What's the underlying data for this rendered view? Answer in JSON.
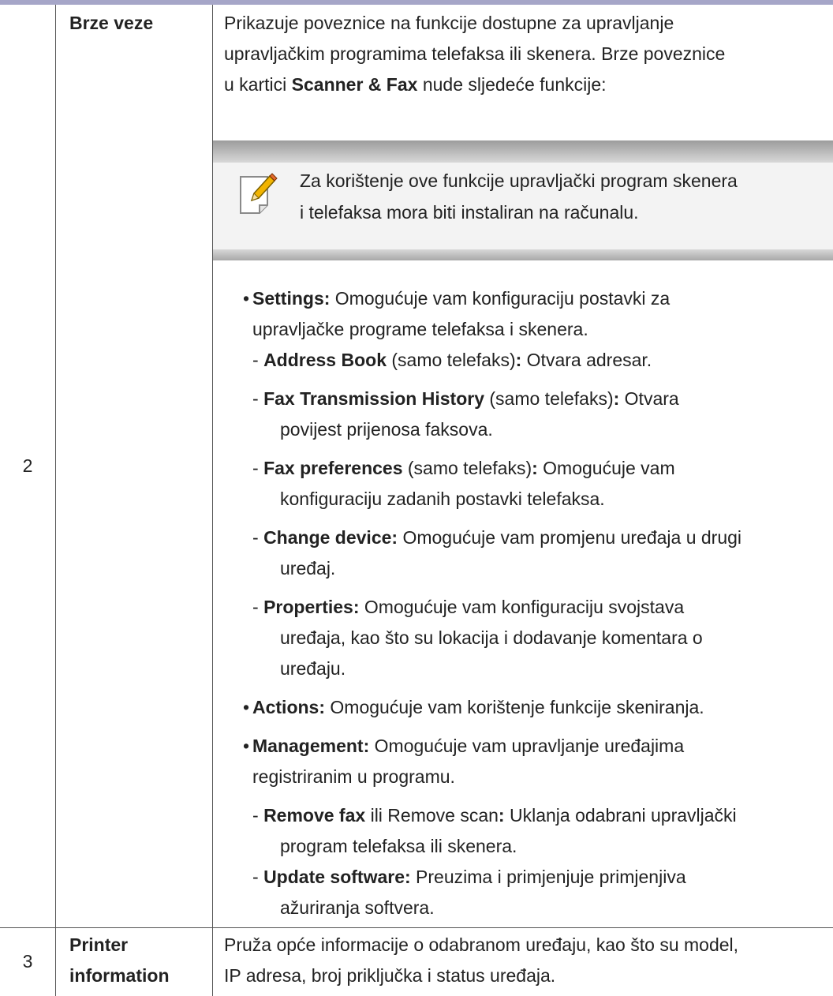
{
  "rows": [
    {
      "number": "2",
      "name": "Brze veze",
      "intro": {
        "line1": "Prikazuje poveznice na funkcije dostupne za upravljanje",
        "line2": "upravljačkim programima telefaksa ili skenera. Brze poveznice",
        "line3_pre": "u kartici ",
        "line3_bold": "Scanner & Fax",
        "line3_post": " nude sljedeće funkcije:"
      },
      "note": {
        "icon": "note-pencil-icon",
        "line1": "Za korištenje ove funkcije upravljački program skenera",
        "line2": "i telefaksa mora biti instaliran na računalu."
      },
      "items": {
        "settings_label": "Settings:",
        "settings_line1": " Omogućuje vam konfiguraciju postavki za",
        "settings_line2": "upravljačke programe telefaksa i skenera.",
        "address_book_label": "Address Book",
        "address_book_paren": " (samo telefaks)",
        "address_book_colon": ":",
        "address_book_text": " Otvara adresar.",
        "fax_history_label": "Fax Transmission History",
        "fax_history_paren": " (samo telefaks)",
        "fax_history_colon": ":",
        "fax_history_line1": " Otvara",
        "fax_history_line2": "povijest prijenosa faksova.",
        "fax_pref_label": "Fax preferences",
        "fax_pref_paren": " (samo telefaks)",
        "fax_pref_colon": ":",
        "fax_pref_line1": " Omogućuje vam",
        "fax_pref_line2": "konfiguraciju zadanih postavki telefaksa.",
        "change_device_label": "Change device:",
        "change_device_line1": " Omogućuje vam promjenu uređaja u drugi",
        "change_device_line2": "uređaj.",
        "properties_label": "Properties:",
        "properties_line1": " Omogućuje vam konfiguraciju svojstava",
        "properties_line2": "uređaja, kao što su lokacija i dodavanje komentara o",
        "properties_line3": "uređaju.",
        "actions_label": "Actions:",
        "actions_text": " Omogućuje vam korištenje funkcije skeniranja.",
        "management_label": "Management:",
        "management_line1": " Omogućuje vam upravljanje uređajima",
        "management_line2": "registriranim u programu.",
        "remove_fax_label": "Remove fax",
        "remove_fax_mid": " ili Remove scan",
        "remove_fax_colon": ":",
        "remove_fax_line1": " Uklanja odabrani upravljački",
        "remove_fax_line2": "program telefaksa ili skenera.",
        "update_label": "Update software:",
        "update_line1": " Preuzima i primjenjuje primjenjiva",
        "update_line2": "ažuriranja softvera."
      }
    },
    {
      "number": "3",
      "name_line1": "Printer",
      "name_line2": "information",
      "desc_line1": "Pruža opće informacije o odabranom uređaju, kao što su model,",
      "desc_line2": "IP adresa, broj priključka i status uređaja."
    }
  ]
}
